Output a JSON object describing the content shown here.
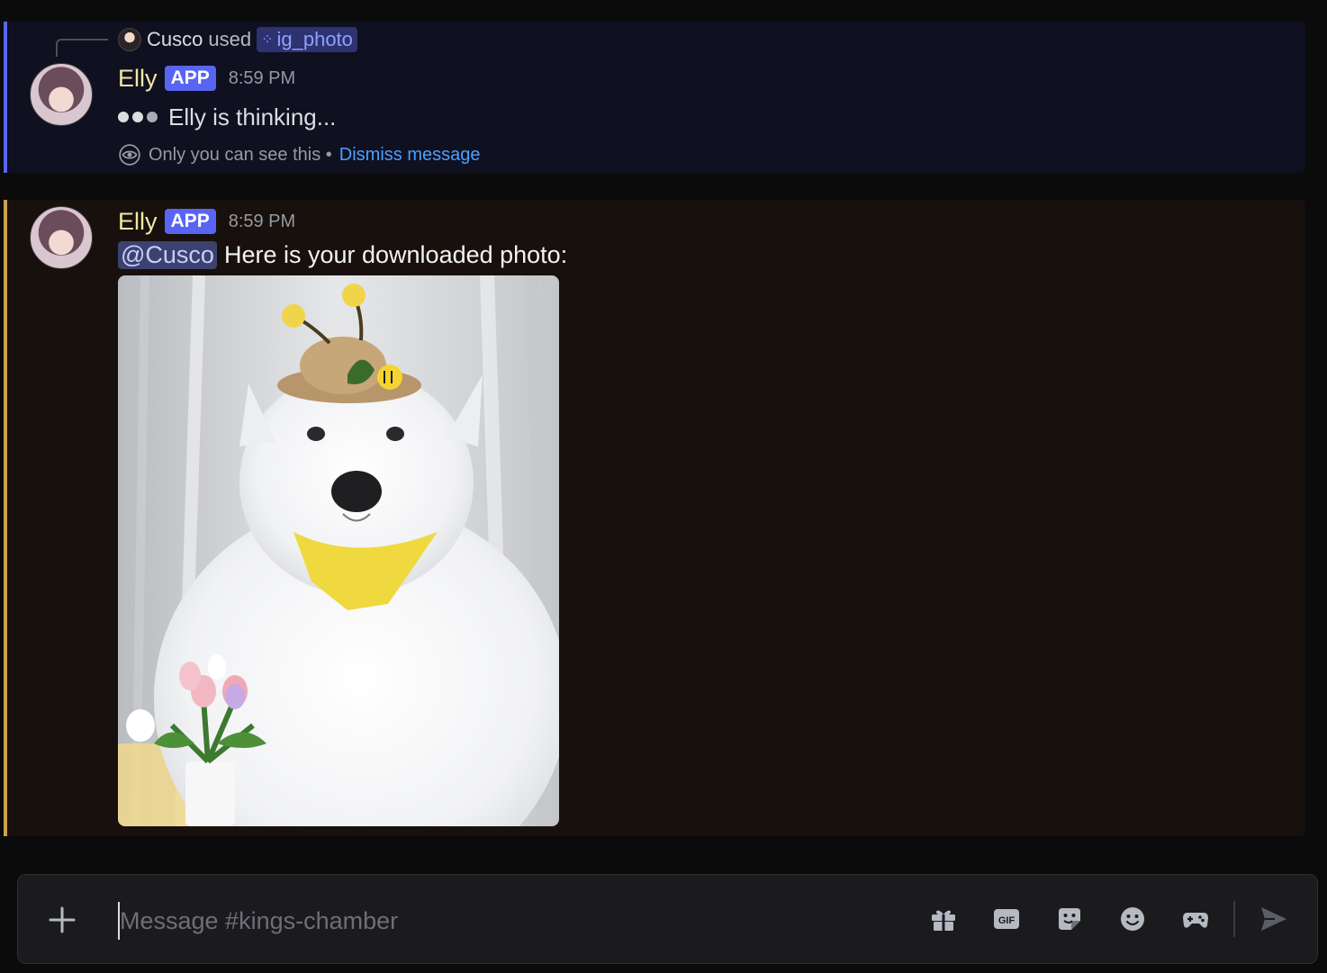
{
  "ephemeral_message": {
    "command_user": "Cusco",
    "command_used_text": "used",
    "command_name": "ig_photo",
    "author": "Elly",
    "badge": "APP",
    "time": "8:59 PM",
    "thinking_text": "Elly is thinking...",
    "visibility_note": "Only you can see this •",
    "dismiss_label": "Dismiss message"
  },
  "reply_message": {
    "author": "Elly",
    "badge": "APP",
    "time": "8:59 PM",
    "mention": "@Cusco",
    "text": "Here is your downloaded photo:"
  },
  "composer": {
    "placeholder": "Message #kings-chamber",
    "icons": [
      "plus-icon",
      "gift-icon",
      "gif-icon",
      "sticker-icon",
      "emoji-icon",
      "gamepad-icon",
      "send-icon"
    ],
    "gif_label": "GIF"
  },
  "colors": {
    "accent": "#5865f2",
    "username": "#f3e7a6",
    "link": "#4c9ffe",
    "mention_border": "#c9a24b"
  }
}
